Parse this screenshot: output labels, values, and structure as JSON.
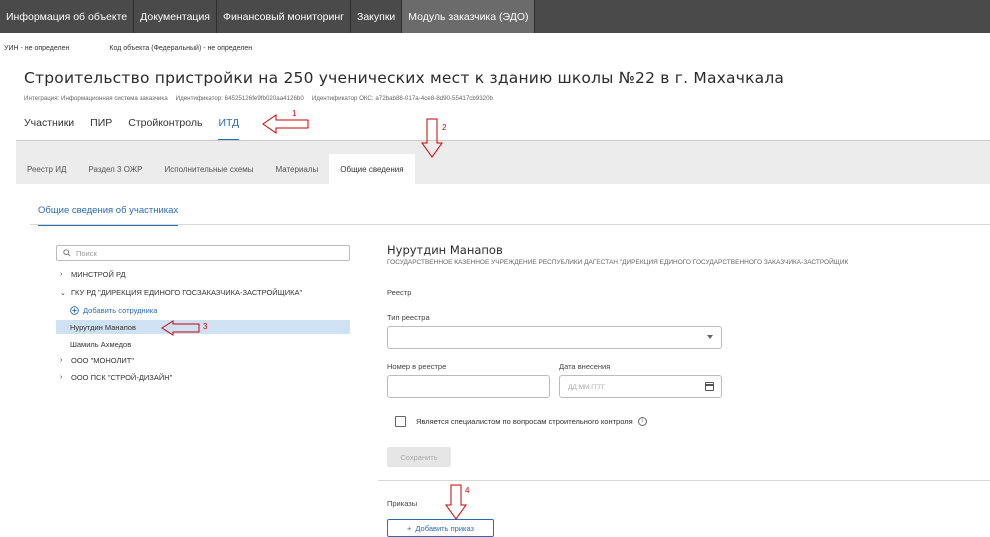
{
  "topnav": {
    "tabs": [
      {
        "label": "Информация об объекте"
      },
      {
        "label": "Документация"
      },
      {
        "label": "Финансовый мониторинг"
      },
      {
        "label": "Закупки"
      },
      {
        "label": "Модуль заказчика (ЭДО)"
      }
    ]
  },
  "meta": {
    "uin": "УИН - не определен",
    "object_code": "Код объекта (Федеральный) - не определен"
  },
  "object": {
    "title": "Строительство пристройки на 250 ученических мест к зданию школы №22 в г. Махачкала",
    "integration": "Интеграция: Информационная система заказчика",
    "identifier": "Идентификатор: 64525126fe9fb020aa4126b0",
    "oks_identifier": "Идентификатор ОКС: a72bab88-017a-4ce8-8d90-55417cb9320b"
  },
  "main_tabs": [
    {
      "label": "Участники"
    },
    {
      "label": "ПИР"
    },
    {
      "label": "Стройконтроль"
    },
    {
      "label": "ИТД"
    }
  ],
  "sub_tabs": [
    {
      "label": "Реестр ИД"
    },
    {
      "label": "Раздел 3 ОЖР"
    },
    {
      "label": "Исполнительные схемы"
    },
    {
      "label": "Материалы"
    },
    {
      "label": "Общие сведения"
    }
  ],
  "section_tab": "Общие сведения об участниках",
  "tree": {
    "search_placeholder": "Поиск",
    "nodes": [
      {
        "label": "МИНСТРОЙ РД"
      },
      {
        "label": "ГКУ РД \"ДИРЕКЦИЯ ЕДИНОГО ГОСЗАКАЗЧИКА-ЗАСТРОЙЩИКА\""
      },
      {
        "label": "ООО \"МОНОЛИТ\""
      },
      {
        "label": "ООО ПСК \"СТРОЙ-ДИЗАЙН\""
      }
    ],
    "add_employee": "Добавить сотрудника",
    "people": [
      {
        "label": "Нурутдин Манапов"
      },
      {
        "label": "Шамиль Ахмедов"
      }
    ]
  },
  "details": {
    "name": "Нурутдин Манапов",
    "org": "ГОСУДАРСТВЕННОЕ КАЗЕННОЕ УЧРЕЖДЕНИЕ РЕСПУБЛИКИ ДАГЕСТАН \"ДИРЕКЦИЯ ЕДИНОГО ГОСУДАРСТВЕННОГО ЗАКАЗЧИКА-ЗАСТРОЙЩИК",
    "registry_section": "Реестр",
    "registry_type_label": "Тип реестра",
    "registry_number_label": "Номер в реестре",
    "date_label": "Дата внесения",
    "date_placeholder": "ДД.ММ.ГГГГ",
    "specialist_label": "Является специалистом по вопросам строительного контроля",
    "save_label": "Сохранить",
    "orders_label": "Приказы",
    "add_order_label": "Добавить приказ"
  },
  "annotations": [
    "1",
    "2",
    "3",
    "4"
  ],
  "colors": {
    "nav_bg": "#4a4a4a",
    "accent": "#2b6cb0",
    "annotation": "#cc0000",
    "selection": "#cfe2f3"
  }
}
